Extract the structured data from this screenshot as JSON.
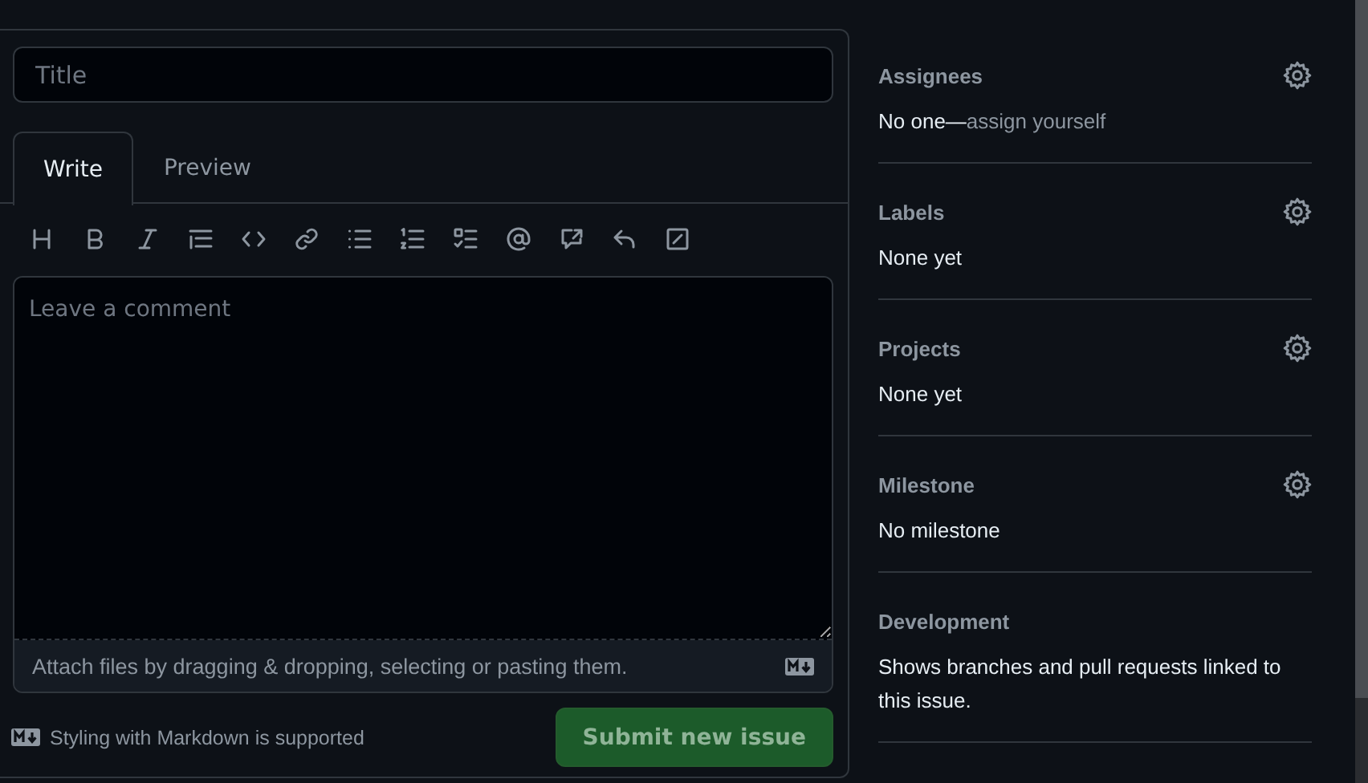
{
  "title_field": {
    "placeholder": "Title"
  },
  "tabs": [
    {
      "label": "Write",
      "selected": true
    },
    {
      "label": "Preview",
      "selected": false
    }
  ],
  "comment_field": {
    "placeholder": "Leave a comment"
  },
  "attach_hint": "Attach files by dragging & dropping, selecting or pasting them.",
  "markdown_note": "Styling with Markdown is supported",
  "submit_button": {
    "label": "Submit new issue",
    "disabled": true
  },
  "sidebar": [
    {
      "heading": "Assignees",
      "has_settings": true,
      "value": "No one—",
      "link": "assign yourself"
    },
    {
      "heading": "Labels",
      "has_settings": true,
      "value": "None yet"
    },
    {
      "heading": "Projects",
      "has_settings": true,
      "value": "None yet"
    },
    {
      "heading": "Milestone",
      "has_settings": true,
      "value": "No milestone"
    },
    {
      "heading": "Development",
      "has_settings": false,
      "value": "Shows branches and pull requests linked to this issue."
    }
  ]
}
